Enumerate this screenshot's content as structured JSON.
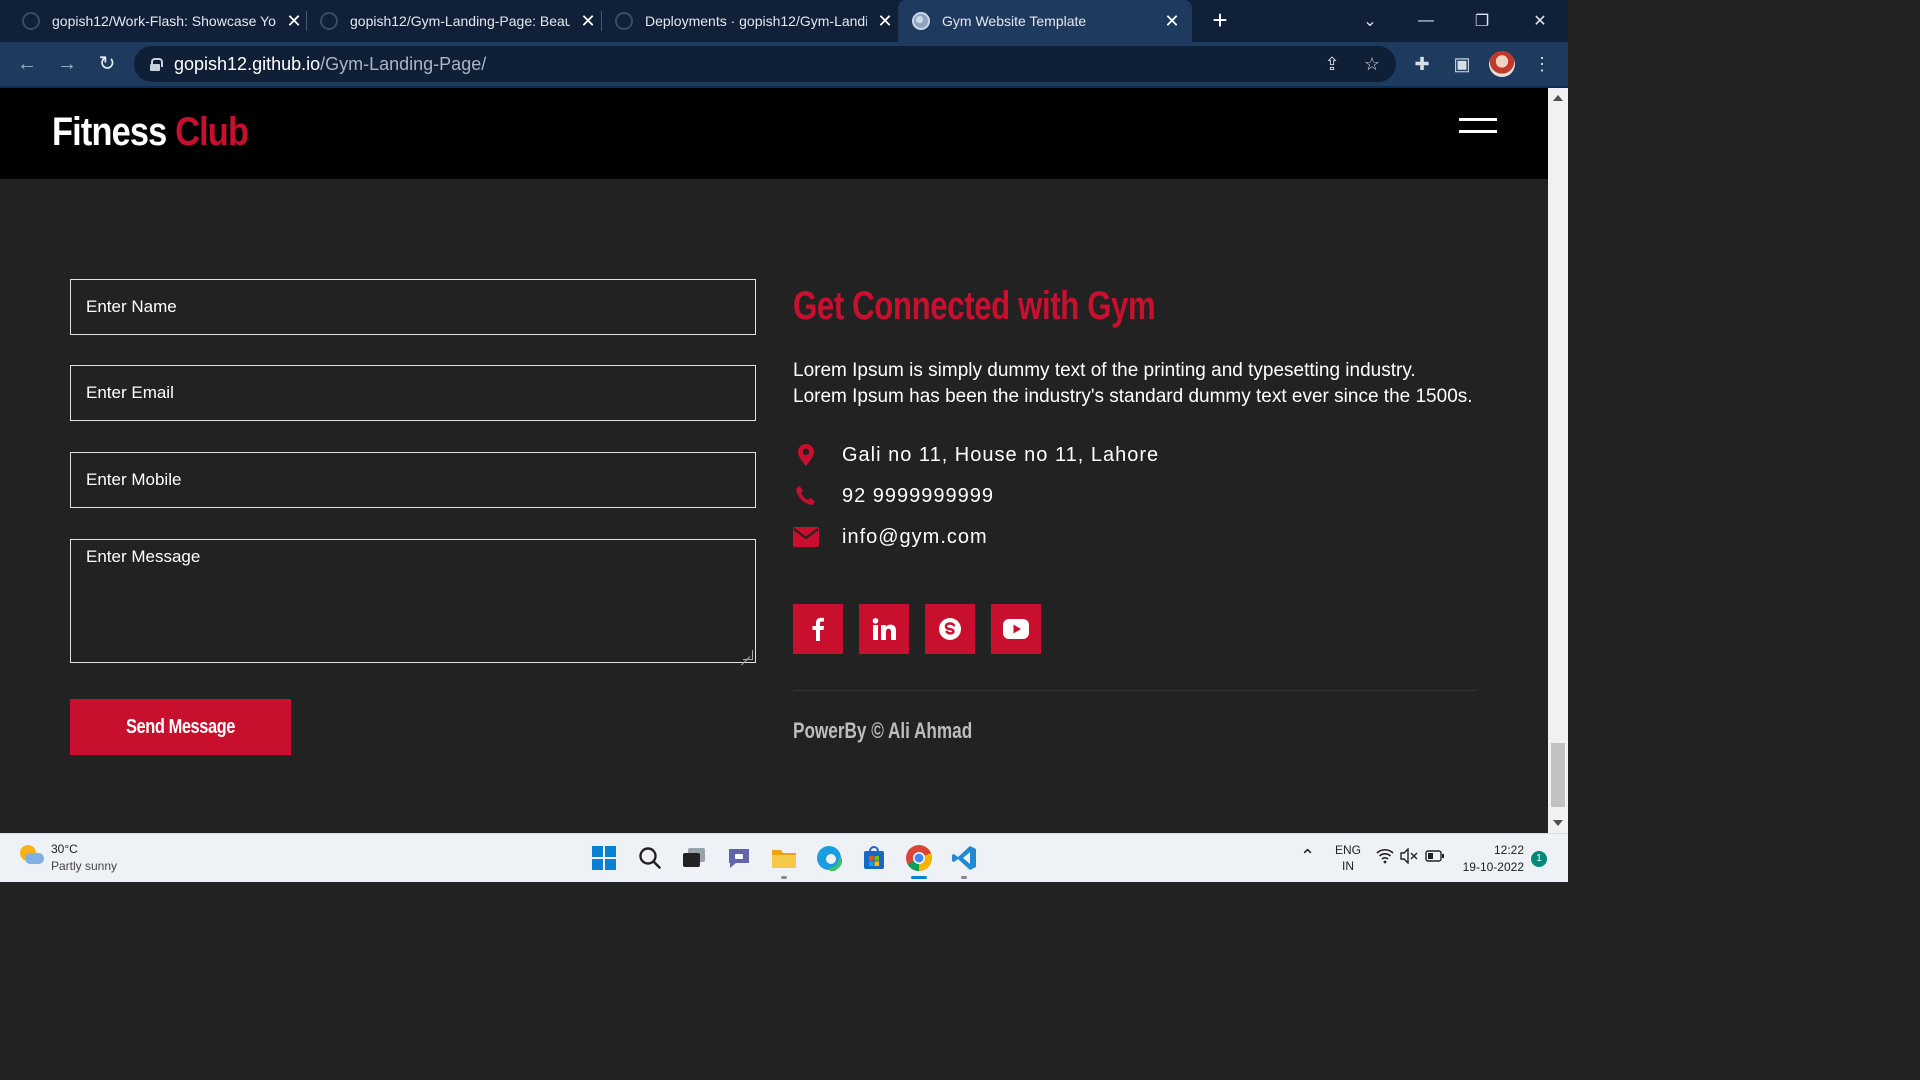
{
  "browser": {
    "tabs": [
      {
        "title": "gopish12/Work-Flash: Showcase You",
        "active": false
      },
      {
        "title": "gopish12/Gym-Landing-Page: Beau",
        "active": false
      },
      {
        "title": "Deployments · gopish12/Gym-Landi",
        "active": false
      },
      {
        "title": "Gym Website Template",
        "active": true
      }
    ],
    "new_tab_label": "+",
    "url_host": "gopish12.github.io",
    "url_path": "/Gym-Landing-Page/"
  },
  "site": {
    "logo_part1": "Fitness",
    "logo_part2": "Club",
    "brand_color": "#c8102e"
  },
  "form": {
    "name_placeholder": "Enter Name",
    "email_placeholder": "Enter Email",
    "mobile_placeholder": "Enter Mobile",
    "message_placeholder": "Enter Message",
    "submit_label": "Send Message"
  },
  "contact": {
    "heading": "Get Connected with Gym",
    "description": "Lorem Ipsum is simply dummy text of the printing and typesetting industry. Lorem Ipsum has been the industry's standard dummy text ever since the 1500s.",
    "address": "Gali no 11, House no 11, Lahore",
    "phone": "92 9999999999",
    "email": "info@gym.com",
    "icons": [
      "map-marker-icon",
      "phone-icon",
      "envelope-icon"
    ]
  },
  "social": [
    "facebook-icon",
    "linkedin-icon",
    "skype-icon",
    "youtube-icon"
  ],
  "footer": {
    "powered_by": "PowerBy © Ali Ahmad"
  },
  "taskbar": {
    "weather_temp": "30°C",
    "weather_desc": "Partly sunny",
    "lang_top": "ENG",
    "lang_bottom": "IN",
    "time": "12:22",
    "date": "19-10-2022",
    "notification_count": "1"
  }
}
